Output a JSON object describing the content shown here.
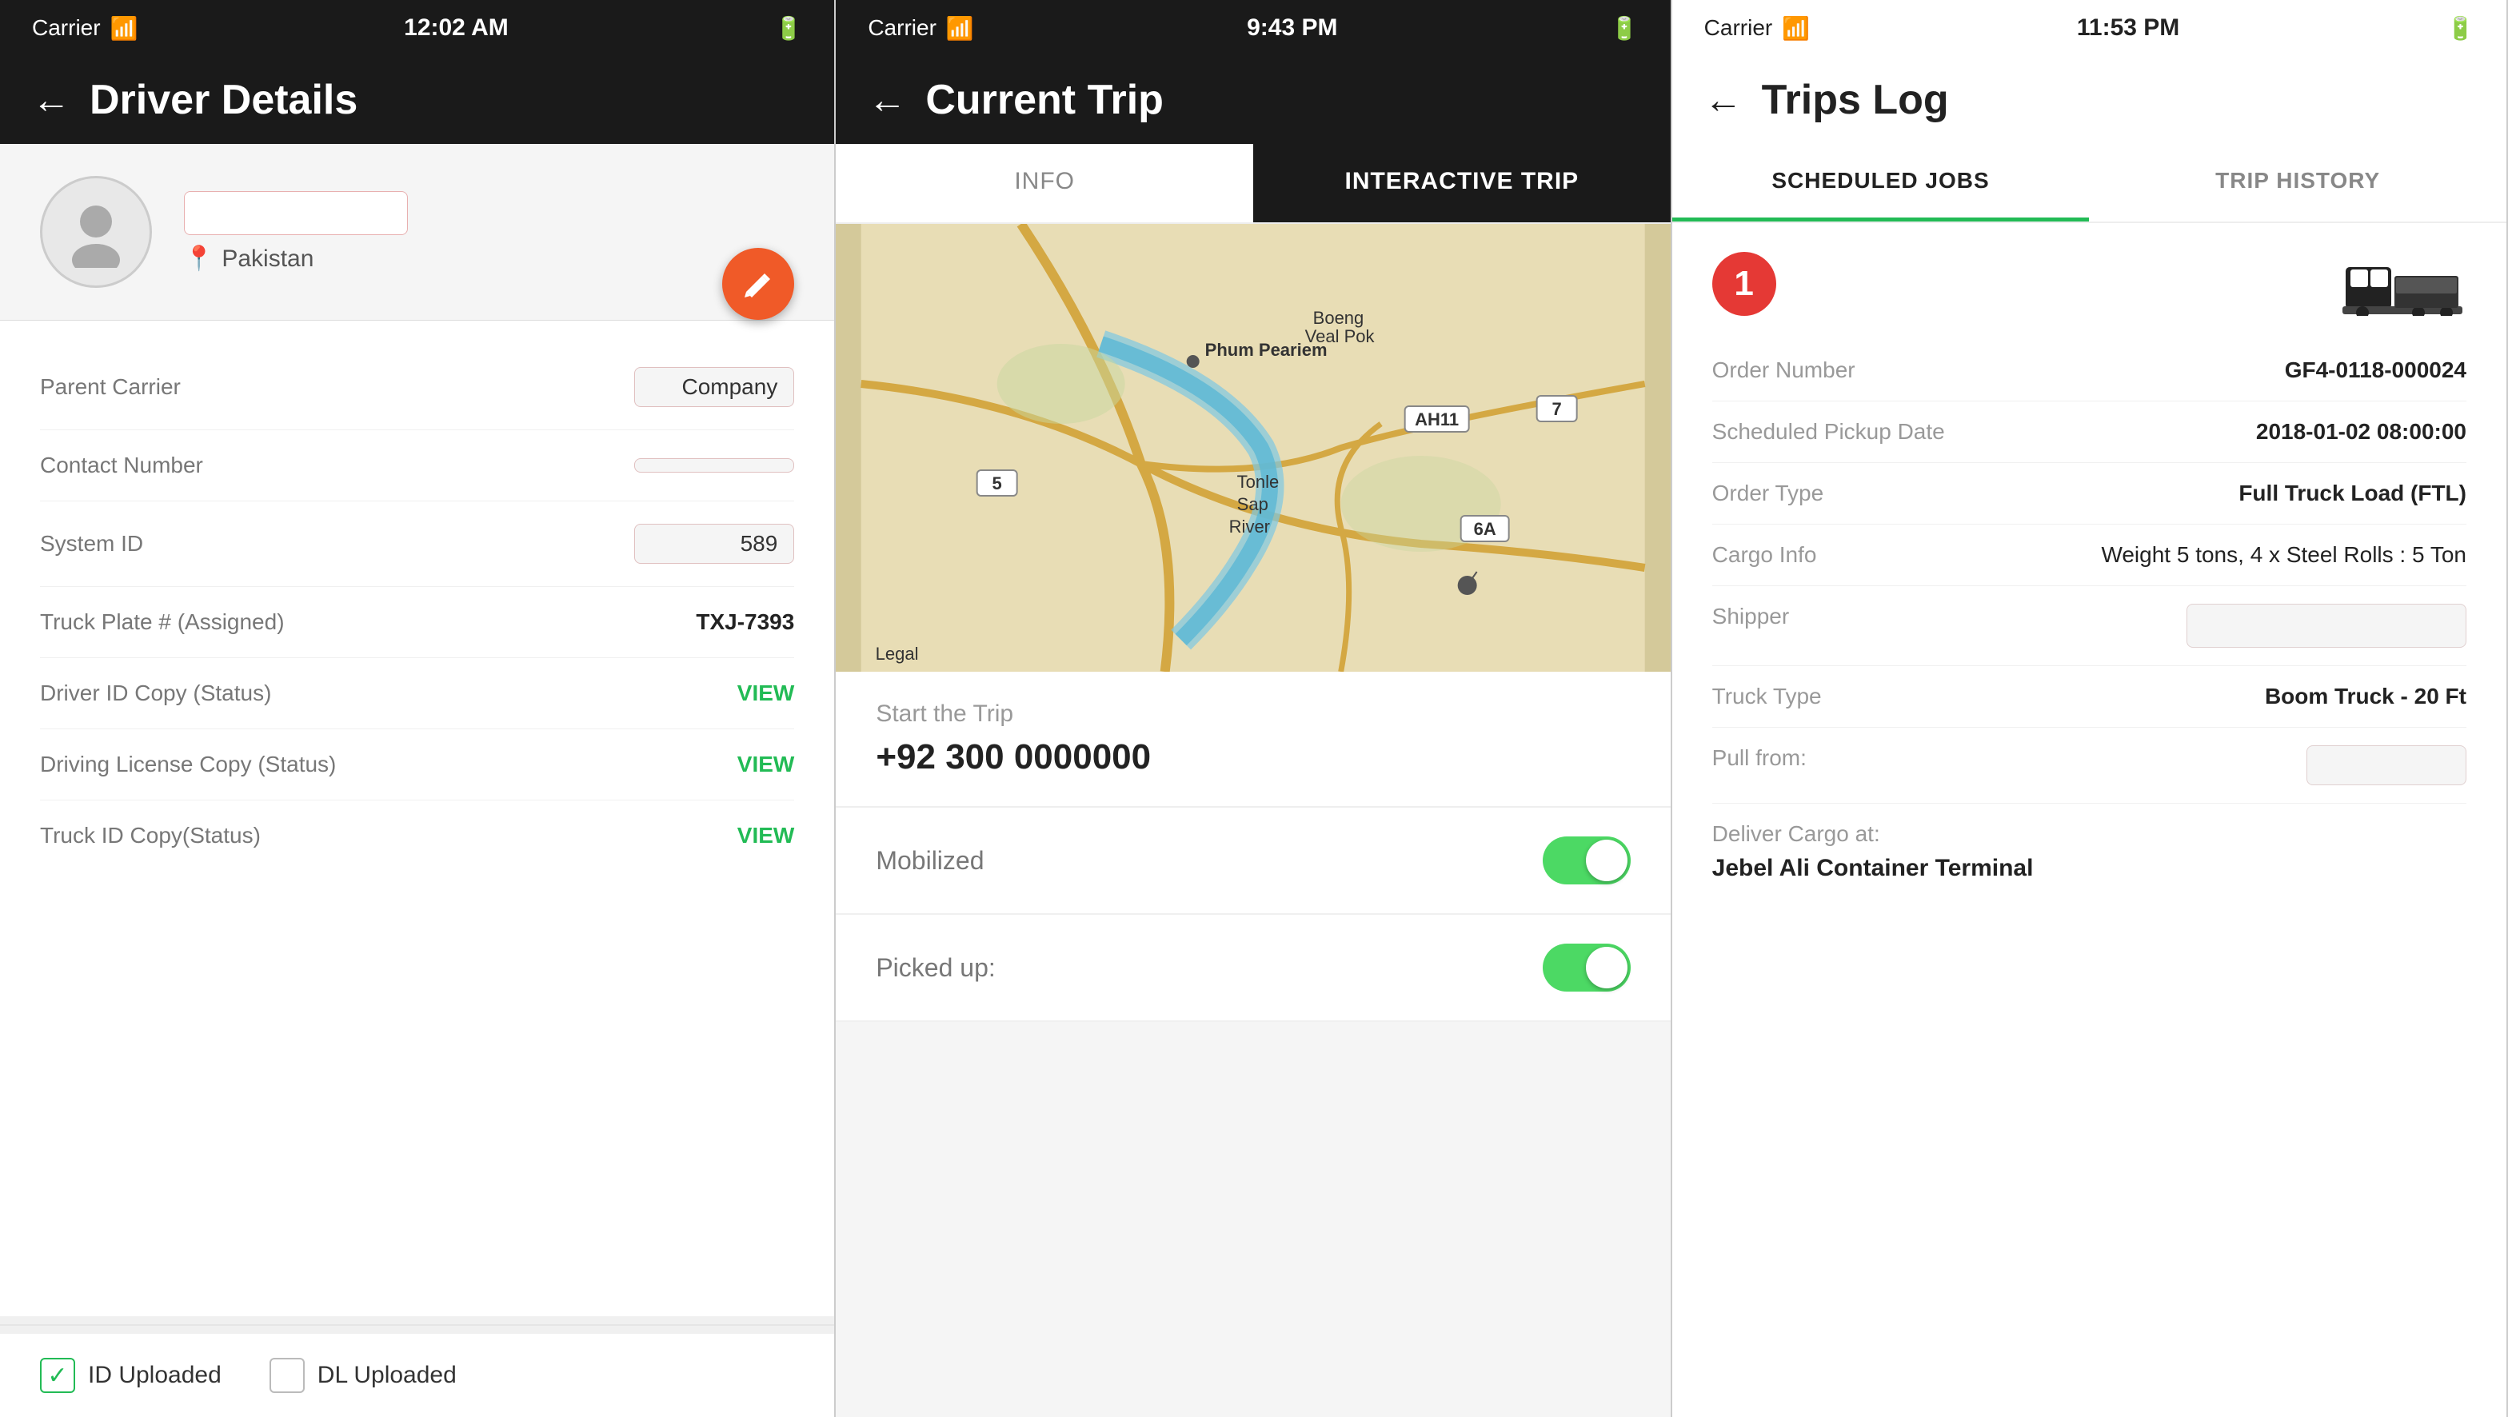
{
  "panel1": {
    "statusBar": {
      "carrier": "Carrier",
      "time": "12:02 AM",
      "battery": "■■"
    },
    "header": {
      "back": "←",
      "title": "Driver Details"
    },
    "profile": {
      "location": "Pakistan"
    },
    "fields": {
      "parentCarrier": {
        "label": "Parent Carrier",
        "value": "Company"
      },
      "contactNumber": {
        "label": "Contact Number",
        "value": ""
      },
      "systemId": {
        "label": "System ID",
        "value": "589"
      },
      "truckPlate": {
        "label": "Truck Plate # (Assigned)",
        "value": "TXJ-7393"
      },
      "driverIdCopy": {
        "label": "Driver  ID Copy (Status)",
        "value": "VIEW"
      },
      "drivingLicense": {
        "label": "Driving License Copy (Status)",
        "value": "VIEW"
      },
      "truckIdCopy": {
        "label": "Truck ID Copy(Status)",
        "value": "VIEW"
      }
    },
    "checkboxes": {
      "idUploaded": {
        "label": "ID Uploaded",
        "checked": true
      },
      "dlUploaded": {
        "label": "DL Uploaded",
        "checked": false
      }
    }
  },
  "panel2": {
    "statusBar": {
      "carrier": "Carrier",
      "time": "9:43 PM",
      "battery": "■■■"
    },
    "header": {
      "back": "←",
      "title": "Current Trip"
    },
    "tabs": [
      {
        "label": "INFO",
        "active": false
      },
      {
        "label": "INTERACTIVE TRIP",
        "active": true
      }
    ],
    "map": {
      "legalLabel": "Legal",
      "placeName": "Phum Peariem",
      "riverName": "Tonle Sap River",
      "roadLabels": [
        "5",
        "7",
        "AH11",
        "6A"
      ]
    },
    "startTrip": {
      "label": "Start the Trip",
      "phone": "+92 300 0000000"
    },
    "toggles": [
      {
        "label": "Mobilized",
        "on": true
      },
      {
        "label": "Picked up:",
        "on": true
      }
    ]
  },
  "panel3": {
    "statusBar": {
      "carrier": "Carrier",
      "time": "11:53 PM",
      "battery": "■"
    },
    "header": {
      "back": "←",
      "title": "Trips Log"
    },
    "tabs": [
      {
        "label": "SCHEDULED JOBS",
        "active": true
      },
      {
        "label": "TRIP HISTORY",
        "active": false
      }
    ],
    "badge": "1",
    "order": {
      "orderNumber": {
        "label": "Order Number",
        "value": "GF4-0118-000024"
      },
      "scheduledPickup": {
        "label": "Scheduled  Pickup Date",
        "value": "2018-01-02 08:00:00"
      },
      "orderType": {
        "label": "Order Type",
        "value": "Full Truck Load (FTL)"
      },
      "cargoInfo": {
        "label": "Cargo Info",
        "value": "Weight 5 tons, 4 x Steel Rolls : 5 Ton"
      },
      "shipper": {
        "label": "Shipper",
        "value": ""
      },
      "truckType": {
        "label": "Truck Type",
        "value": "Boom Truck - 20 Ft"
      },
      "pullFrom": {
        "label": "Pull from:",
        "value": ""
      },
      "deliverCargo": {
        "label": "Deliver Cargo at:",
        "value": "Jebel Ali Container Terminal"
      }
    }
  }
}
